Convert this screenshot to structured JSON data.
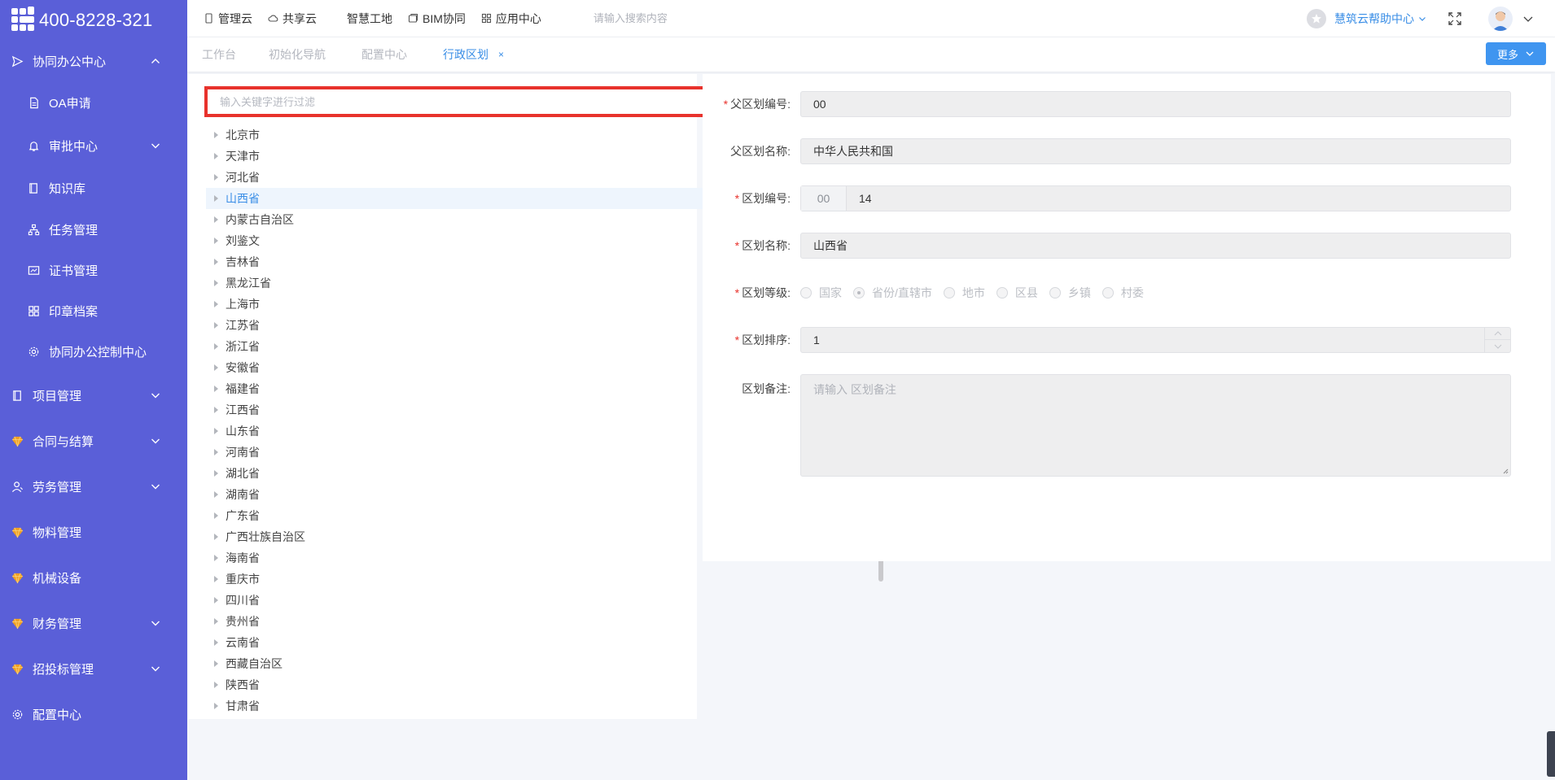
{
  "brand": {
    "phone": "400-8228-321"
  },
  "sidebar": {
    "items": [
      {
        "label": "协同办公中心",
        "icon": "send-icon",
        "expanded": true
      },
      {
        "label": "OA申请",
        "icon": "document-icon",
        "sub": true
      },
      {
        "label": "审批中心",
        "icon": "bell-icon",
        "sub": true,
        "has_children": true
      },
      {
        "label": "知识库",
        "icon": "book-icon",
        "sub": true
      },
      {
        "label": "任务管理",
        "icon": "hierarchy-icon",
        "sub": true
      },
      {
        "label": "证书管理",
        "icon": "certificate-icon",
        "sub": true
      },
      {
        "label": "印章档案",
        "icon": "grid-icon",
        "sub": true
      },
      {
        "label": "协同办公控制中心",
        "icon": "gear-icon",
        "sub": true
      },
      {
        "label": "项目管理",
        "icon": "book-icon",
        "has_children": true
      },
      {
        "label": "合同与结算",
        "icon": "gem-icon",
        "has_children": true
      },
      {
        "label": "劳务管理",
        "icon": "user-icon",
        "has_children": true
      },
      {
        "label": "物料管理",
        "icon": "gem-icon"
      },
      {
        "label": "机械设备",
        "icon": "gem-icon"
      },
      {
        "label": "财务管理",
        "icon": "gem-icon",
        "has_children": true
      },
      {
        "label": "招投标管理",
        "icon": "gem-icon",
        "has_children": true
      },
      {
        "label": "配置中心",
        "icon": "gear-icon"
      }
    ]
  },
  "topnav": {
    "items": [
      {
        "label": "管理云",
        "icon": "phone-icon"
      },
      {
        "label": "共享云",
        "icon": "cloud-icon"
      },
      {
        "label": "智慧工地",
        "icon": "book-icon"
      },
      {
        "label": "BIM协同",
        "icon": "cube-icon"
      },
      {
        "label": "应用中心",
        "icon": "apps-icon"
      }
    ],
    "search_placeholder": "请输入搜索内容",
    "help_label": "慧筑云帮助中心"
  },
  "tabs": {
    "items": [
      {
        "label": "工作台"
      },
      {
        "label": "初始化导航"
      },
      {
        "label": "配置中心"
      },
      {
        "label": "行政区划",
        "active": true,
        "closable": true
      }
    ],
    "more_label": "更多"
  },
  "tree": {
    "filter_placeholder": "输入关键字进行过滤",
    "selected": "山西省",
    "nodes": [
      "北京市",
      "天津市",
      "河北省",
      "山西省",
      "内蒙古自治区",
      "刘鉴文",
      "吉林省",
      "黑龙江省",
      "上海市",
      "江苏省",
      "浙江省",
      "安徽省",
      "福建省",
      "江西省",
      "山东省",
      "河南省",
      "湖北省",
      "湖南省",
      "广东省",
      "广西壮族自治区",
      "海南省",
      "重庆市",
      "四川省",
      "贵州省",
      "云南省",
      "西藏自治区",
      "陕西省",
      "甘肃省"
    ]
  },
  "form": {
    "parent_code": {
      "label": "父区划编号:",
      "required": true,
      "value": "00"
    },
    "parent_name": {
      "label": "父区划名称:",
      "required": false,
      "value": "中华人民共和国"
    },
    "code": {
      "label": "区划编号:",
      "required": true,
      "prefix": "00",
      "value": "14"
    },
    "name": {
      "label": "区划名称:",
      "required": true,
      "value": "山西省"
    },
    "level": {
      "label": "区划等级:",
      "required": true,
      "options": [
        "国家",
        "省份/直辖市",
        "地市",
        "区县",
        "乡镇",
        "村委"
      ],
      "selected": "省份/直辖市"
    },
    "sort": {
      "label": "区划排序:",
      "required": true,
      "value": "1"
    },
    "remark": {
      "label": "区划备注:",
      "required": false,
      "placeholder": "请输入 区划备注"
    }
  },
  "colors": {
    "sidebar_bg": "#5a5fd8",
    "accent": "#3a8ee6",
    "highlight_border": "#e8322c",
    "required_mark": "#e8322c"
  }
}
